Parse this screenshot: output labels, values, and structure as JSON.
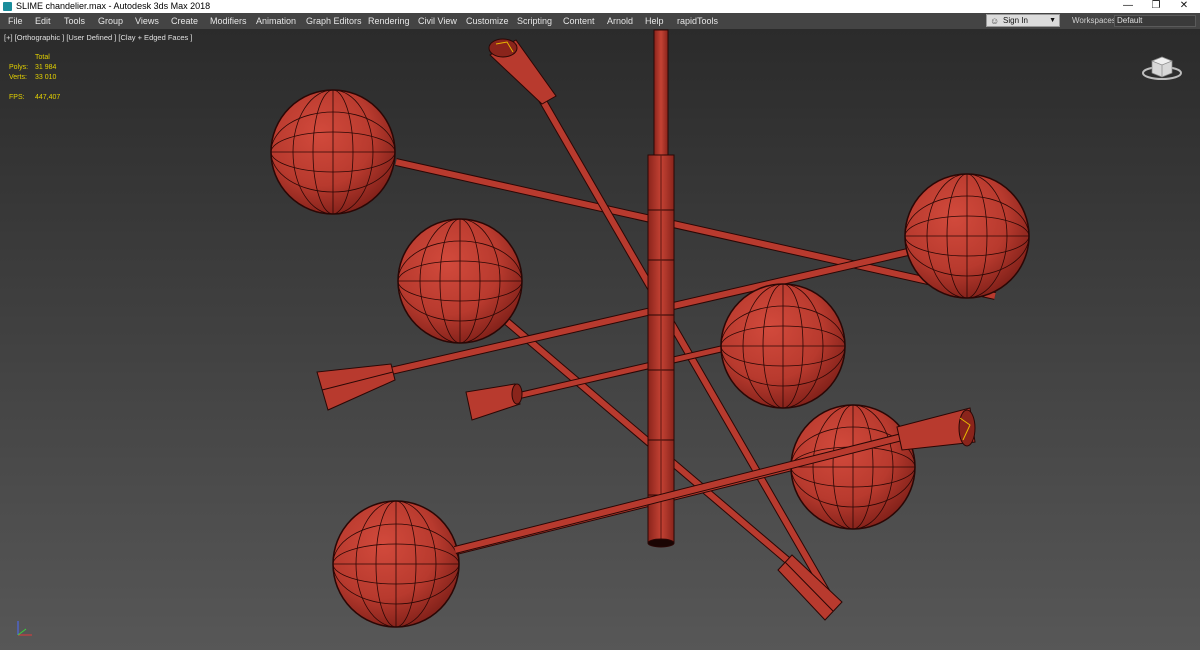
{
  "window": {
    "title": "SLIME chandelier.max - Autodesk 3ds Max 2018",
    "minimize_glyph": "—",
    "maximize_glyph": "❐",
    "close_glyph": "✕"
  },
  "menu": {
    "items": [
      "File",
      "Edit",
      "Tools",
      "Group",
      "Views",
      "Create",
      "Modifiers",
      "Animation",
      "Graph Editors",
      "Rendering",
      "Civil View",
      "Customize",
      "Scripting",
      "Content",
      "Arnold",
      "Help",
      "rapidTools"
    ]
  },
  "account": {
    "signin_label": "Sign In",
    "caret": "▼"
  },
  "workspaces": {
    "label": "Workspaces:",
    "value": "Default"
  },
  "viewport": {
    "label": "[+] [Orthographic ] [User Defined ] [Clay + Edged Faces ]",
    "stats": {
      "header": "Total",
      "polys_label": "Polys:",
      "polys_value": "31 984",
      "verts_label": "Verts:",
      "verts_value": "33 010",
      "fps_label": "FPS:",
      "fps_value": "447,407"
    }
  },
  "colors": {
    "clay": "#b83a2e",
    "clay_dark": "#7e1f18",
    "wire": "#2a0705",
    "stats_text": "#e4d200"
  }
}
